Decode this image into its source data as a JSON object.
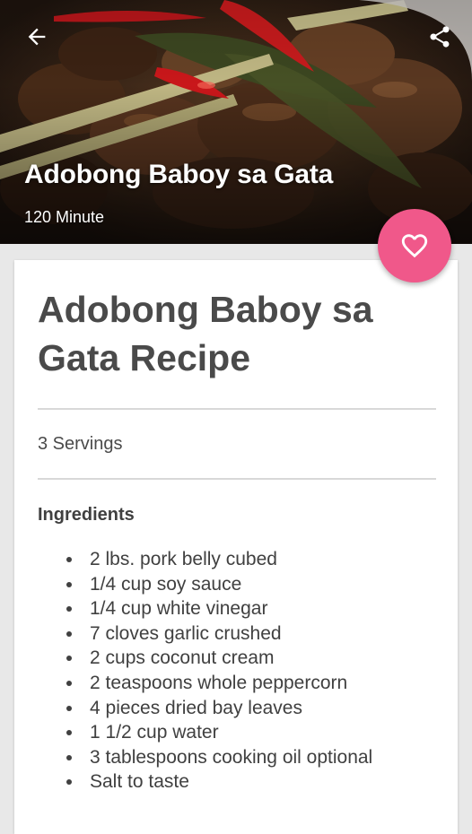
{
  "header": {
    "title": "Adobong Baboy sa Gata",
    "duration": "120 Minute",
    "back_icon": "arrow-back-icon",
    "share_icon": "share-icon"
  },
  "favorite": {
    "icon": "heart-outline-icon",
    "color": "#f0588a"
  },
  "recipe": {
    "title": "Adobong Baboy sa Gata Recipe",
    "servings": "3 Servings",
    "ingredients_heading": "Ingredients",
    "ingredients": [
      "2 lbs. pork belly cubed",
      "1/4 cup soy sauce",
      "1/4 cup white vinegar",
      "7 cloves garlic crushed",
      "2 cups coconut cream",
      "2 teaspoons whole peppercorn",
      "4 pieces dried bay leaves",
      "1 1/2 cup water",
      "3 tablespoons cooking oil optional",
      "Salt to taste"
    ]
  }
}
